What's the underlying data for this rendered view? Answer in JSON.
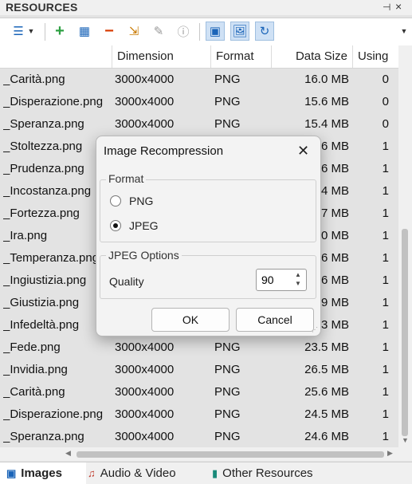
{
  "panel": {
    "title": "RESOURCES",
    "pin_icon": "pin-icon",
    "close_icon": "close-icon"
  },
  "toolbar": {
    "icons": [
      "view-list-icon",
      "dropdown-arrow-icon",
      "add-icon",
      "grid-icon",
      "remove-icon",
      "export-icon",
      "edit-icon",
      "info-icon",
      "image-compress-icon",
      "image-icon",
      "cursor-refresh-icon",
      "overflow-arrow-icon"
    ]
  },
  "table": {
    "columns": [
      "",
      "Dimension",
      "Format",
      "Data Size",
      "Using"
    ],
    "rows": [
      {
        "name": "_Carità.png",
        "dim": "3000x4000",
        "fmt": "PNG",
        "size": "16.0 MB",
        "use": "0"
      },
      {
        "name": "_Disperazione.png",
        "dim": "3000x4000",
        "fmt": "PNG",
        "size": "15.6 MB",
        "use": "0"
      },
      {
        "name": "_Speranza.png",
        "dim": "3000x4000",
        "fmt": "PNG",
        "size": "15.4 MB",
        "use": "0"
      },
      {
        "name": "_Stoltezza.png",
        "dim": "",
        "fmt": "",
        "size": ".6 MB",
        "use": "1"
      },
      {
        "name": "_Prudenza.png",
        "dim": "",
        "fmt": "",
        "size": ".6 MB",
        "use": "1"
      },
      {
        "name": "_Incostanza.png",
        "dim": "",
        "fmt": "",
        "size": ".4 MB",
        "use": "1"
      },
      {
        "name": "_Fortezza.png",
        "dim": "",
        "fmt": "",
        "size": ".7 MB",
        "use": "1"
      },
      {
        "name": "_Ira.png",
        "dim": "",
        "fmt": "",
        "size": ".0 MB",
        "use": "1"
      },
      {
        "name": "_Temperanza.png",
        "dim": "",
        "fmt": "",
        "size": ".6 MB",
        "use": "1"
      },
      {
        "name": "_Ingiustizia.png",
        "dim": "",
        "fmt": "",
        "size": ".6 MB",
        "use": "1"
      },
      {
        "name": "_Giustizia.png",
        "dim": "",
        "fmt": "",
        "size": ".9 MB",
        "use": "1"
      },
      {
        "name": "_Infedeltà.png",
        "dim": "",
        "fmt": "",
        "size": ".3 MB",
        "use": "1"
      },
      {
        "name": "_Fede.png",
        "dim": "3000x4000",
        "fmt": "PNG",
        "size": "23.5 MB",
        "use": "1"
      },
      {
        "name": "_Invidia.png",
        "dim": "3000x4000",
        "fmt": "PNG",
        "size": "26.5 MB",
        "use": "1"
      },
      {
        "name": "_Carità.png",
        "dim": "3000x4000",
        "fmt": "PNG",
        "size": "25.6 MB",
        "use": "1"
      },
      {
        "name": "_Disperazione.png",
        "dim": "3000x4000",
        "fmt": "PNG",
        "size": "24.5 MB",
        "use": "1"
      },
      {
        "name": "_Speranza.png",
        "dim": "3000x4000",
        "fmt": "PNG",
        "size": "24.6 MB",
        "use": "1"
      }
    ]
  },
  "tabs": [
    {
      "label": "Images",
      "icon": "images-icon",
      "active": true
    },
    {
      "label": "Audio & Video",
      "icon": "audio-video-icon",
      "active": false
    },
    {
      "label": "Other Resources",
      "icon": "other-resources-icon",
      "active": false
    }
  ],
  "dialog": {
    "title": "Image Recompression",
    "format_group": "Format",
    "options": [
      "PNG",
      "JPEG"
    ],
    "selected": "JPEG",
    "jpeg_group": "JPEG Options",
    "quality_label": "Quality",
    "quality_value": "90",
    "ok_label": "OK",
    "cancel_label": "Cancel"
  },
  "colors": {
    "accent": "#1a7fd4",
    "add": "#2ea043",
    "remove": "#d83b01",
    "selected_tool": "#cfe1f5"
  }
}
